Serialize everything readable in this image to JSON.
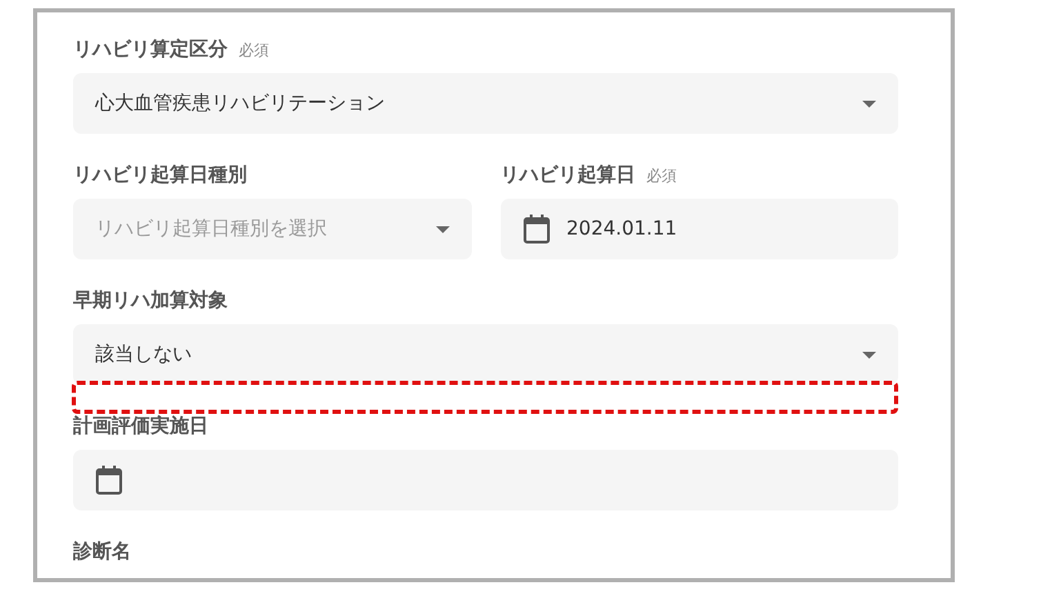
{
  "form_rows": [
    {
      "fields": [
        {
          "kind": "select",
          "label": "リハビリ算定区分",
          "required_text": "必須",
          "value": "心大血管疾患リハビリテーション"
        }
      ]
    },
    {
      "fields": [
        {
          "kind": "select",
          "label": "リハビリ起算日種別",
          "placeholder": "リハビリ起算日種別を選択"
        },
        {
          "kind": "date",
          "label": "リハビリ起算日",
          "required_text": "必須",
          "value": "2024.01.11"
        }
      ]
    },
    {
      "fields": [
        {
          "kind": "select",
          "label": "早期リハ加算対象",
          "value": "該当しない",
          "highlighted": true
        }
      ]
    },
    {
      "fields": [
        {
          "kind": "date",
          "label": "計画評価実施日"
        }
      ]
    },
    {
      "fields": [
        {
          "kind": "label_only",
          "label": "診断名"
        }
      ]
    }
  ]
}
